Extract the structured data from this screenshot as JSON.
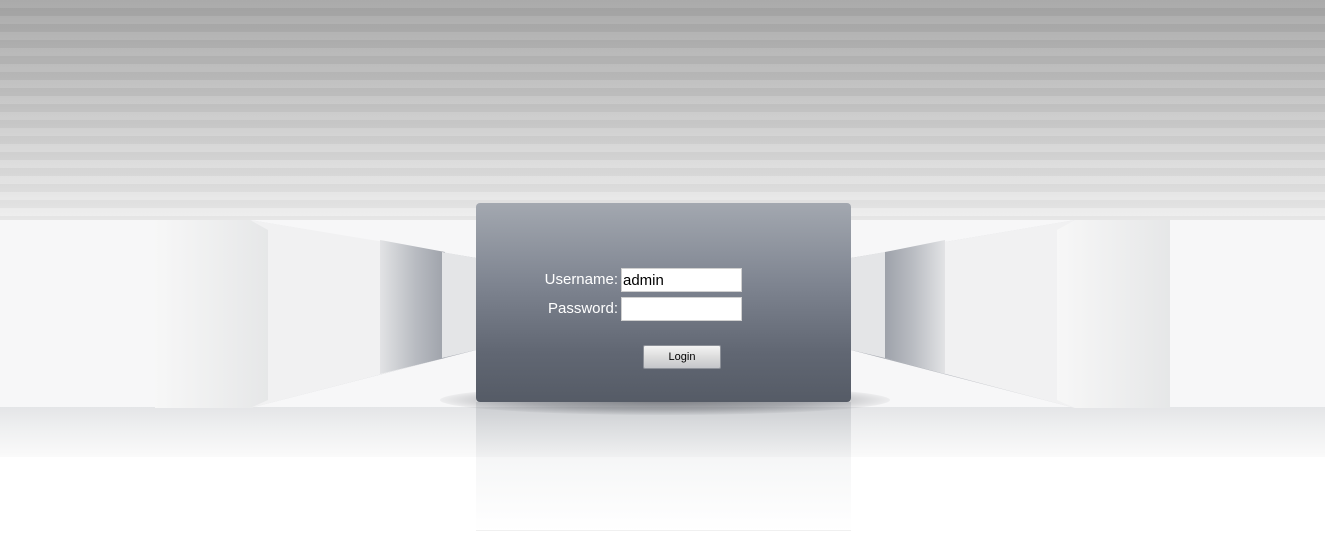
{
  "login": {
    "username_label": "Username:",
    "username_value": "admin",
    "password_label": "Password:",
    "password_value": "",
    "button_label": "Login"
  },
  "colors": {
    "panel_top": "#a3a8b0",
    "panel_bottom": "#555b66",
    "label_text": "#ffffff"
  }
}
